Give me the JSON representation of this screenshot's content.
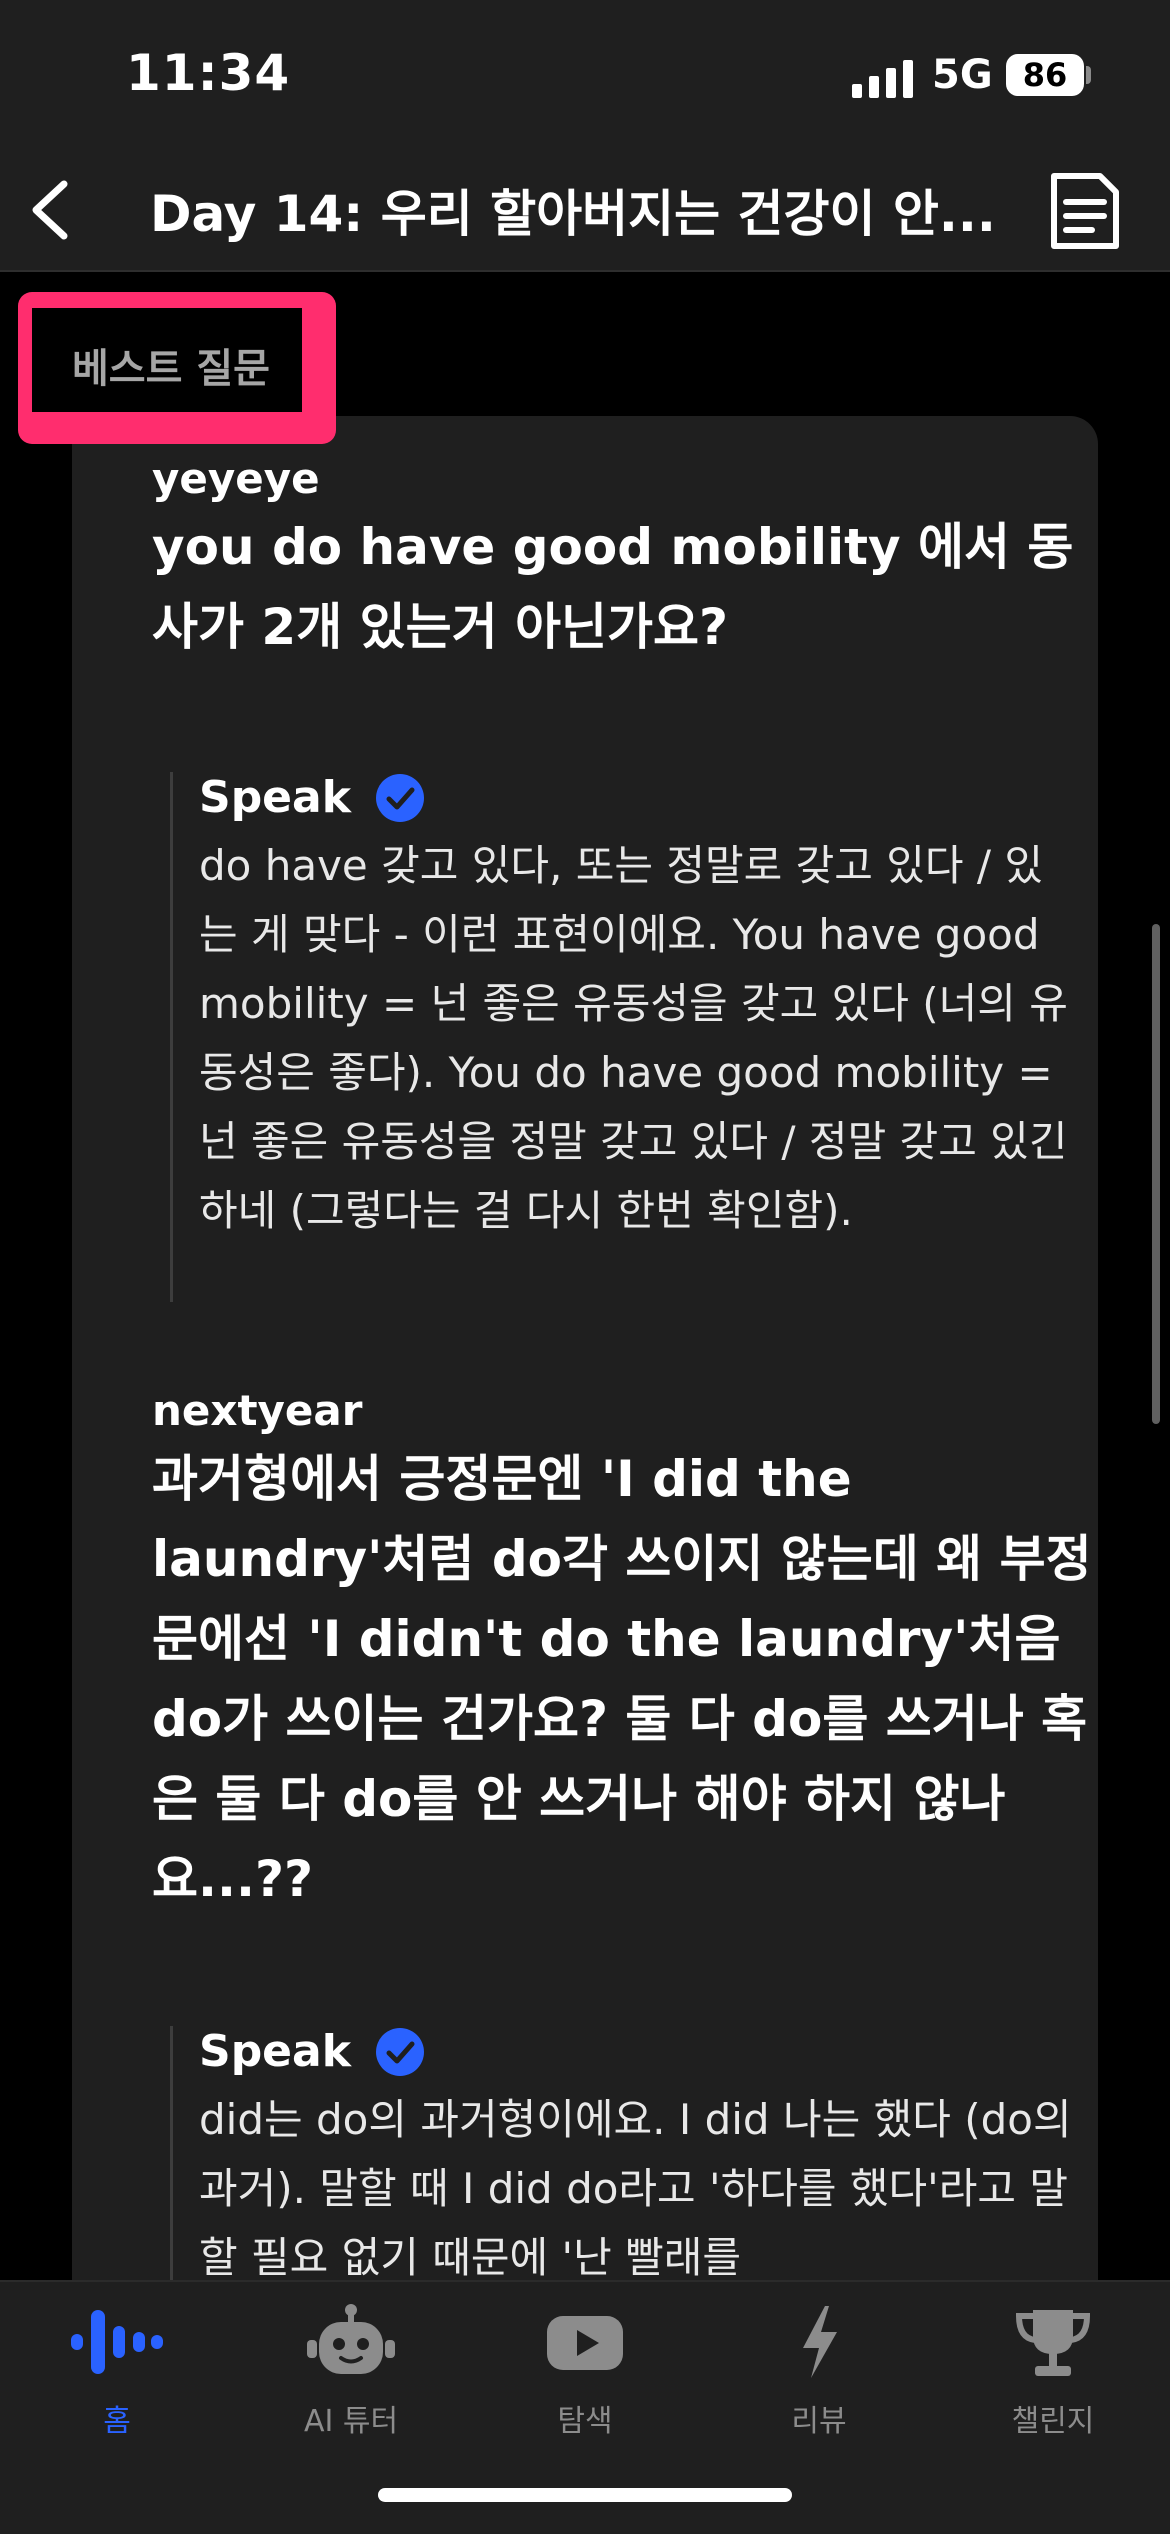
{
  "status_bar": {
    "time": "11:34",
    "network": "5G",
    "battery": "86"
  },
  "header": {
    "title": "Day 14: 우리 할아버지는 건강이 안..."
  },
  "section": {
    "tag": "베스트 질문"
  },
  "questions": [
    {
      "user": "yeyeye",
      "question": "you do have good mobility 에서 동사가 2개 있는거 아닌가요?",
      "answer_author": "Speak",
      "answer": "do have 갖고 있다, 또는 정말로 갖고 있다 / 있는 게 맞다 - 이런 표현이에요. You have good mobility = 넌 좋은 유동성을 갖고 있다 (너의 유동성은 좋다). You do have good mobility = 넌 좋은 유동성을 정말 갖고 있다 / 정말 갖고 있긴 하네 (그렇다는 걸 다시 한번 확인함)."
    },
    {
      "user": "nextyear",
      "question": "과거형에서 긍정문엔 'I did the laundry'처럼 do각 쓰이지 않는데 왜 부정문에선 'I didn't do the laundry'처음 do가 쓰이는 건가요? 둘 다 do를 쓰거나 혹은 둘 다 do를 안 쓰거나 해야 하지 않나요...??",
      "answer_author": "Speak",
      "answer": "did는 do의 과거형이에요. I did 나는 했다 (do의 과거). 말할 때 I did do라고 '하다를 했다'라고 말할 필요 없기 때문에 '난 빨래를"
    }
  ],
  "tabbar": {
    "tabs": [
      {
        "label": "홈",
        "icon": "waveform-icon",
        "active": true
      },
      {
        "label": "AI 튜터",
        "icon": "robot-icon",
        "active": false
      },
      {
        "label": "탐색",
        "icon": "play-icon",
        "active": false
      },
      {
        "label": "리뷰",
        "icon": "lightning-icon",
        "active": false
      },
      {
        "label": "챌린지",
        "icon": "trophy-icon",
        "active": false
      }
    ]
  },
  "colors": {
    "accent": "#2a62ff",
    "highlight": "#ff2d6e",
    "card": "#1f1f1f",
    "background": "#000000"
  }
}
